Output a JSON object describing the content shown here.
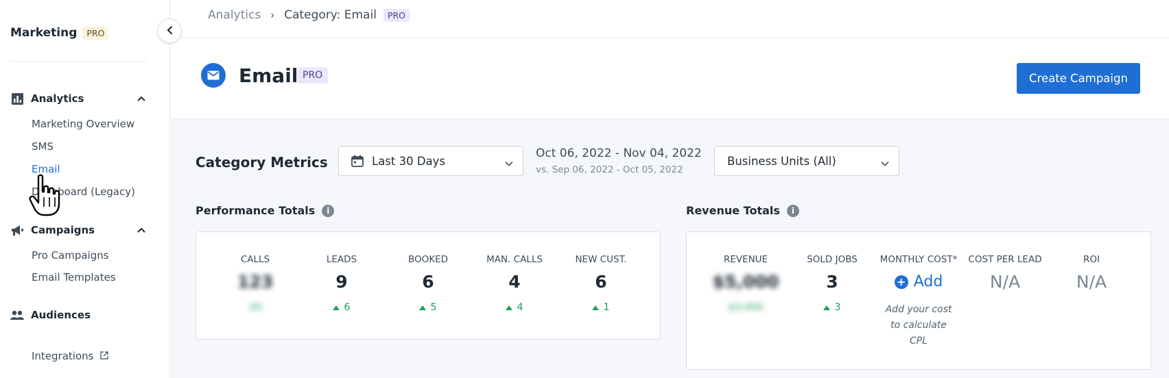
{
  "sidebar": {
    "brand": "Marketing",
    "brand_badge": "PRO",
    "sections": {
      "analytics": {
        "label": "Analytics",
        "items": [
          "Marketing Overview",
          "SMS",
          "Email",
          "Dashboard (Legacy)"
        ]
      },
      "campaigns": {
        "label": "Campaigns",
        "items": [
          "Pro Campaigns",
          "Email Templates"
        ]
      },
      "audiences": {
        "label": "Audiences"
      },
      "integrations": {
        "label": "Integrations"
      }
    },
    "active_item": "Email"
  },
  "breadcrumb": {
    "root": "Analytics",
    "separator": "›",
    "current": "Category: Email",
    "badge": "PRO"
  },
  "header": {
    "title": "Email",
    "badge": "PRO",
    "create_button": "Create Campaign"
  },
  "metrics": {
    "title": "Category Metrics",
    "date_dropdown": "Last 30 Days",
    "date_range": "Oct 06, 2022 - Nov 04, 2022",
    "date_compare": "vs. Sep 06, 2022 - Oct 05, 2022",
    "business_units": "Business Units (All)"
  },
  "performance": {
    "title": "Performance Totals",
    "items": [
      {
        "label": "CALLS",
        "value": "123",
        "delta": "20",
        "blurred": true
      },
      {
        "label": "LEADS",
        "value": "9",
        "delta": "6"
      },
      {
        "label": "BOOKED",
        "value": "6",
        "delta": "5"
      },
      {
        "label": "MAN. CALLS",
        "value": "4",
        "delta": "4"
      },
      {
        "label": "NEW CUST.",
        "value": "6",
        "delta": "1"
      }
    ]
  },
  "revenue": {
    "title": "Revenue Totals",
    "items": [
      {
        "label": "REVENUE",
        "value": "$5,000",
        "delta": "$3,000",
        "blurred": true
      },
      {
        "label": "SOLD JOBS",
        "value": "3",
        "delta": "3"
      },
      {
        "label": "MONTHLY COST*",
        "add_label": "Add",
        "note": "Add your cost to calculate CPL"
      },
      {
        "label": "COST PER LEAD",
        "value": "N/A"
      },
      {
        "label": "ROI",
        "value": "N/A"
      }
    ]
  },
  "colors": {
    "accent": "#1f6ed4",
    "positive": "#1e9e5a",
    "pro_yellow_bg": "#fdf3dc",
    "pro_purple_bg": "#ebe8fb"
  }
}
